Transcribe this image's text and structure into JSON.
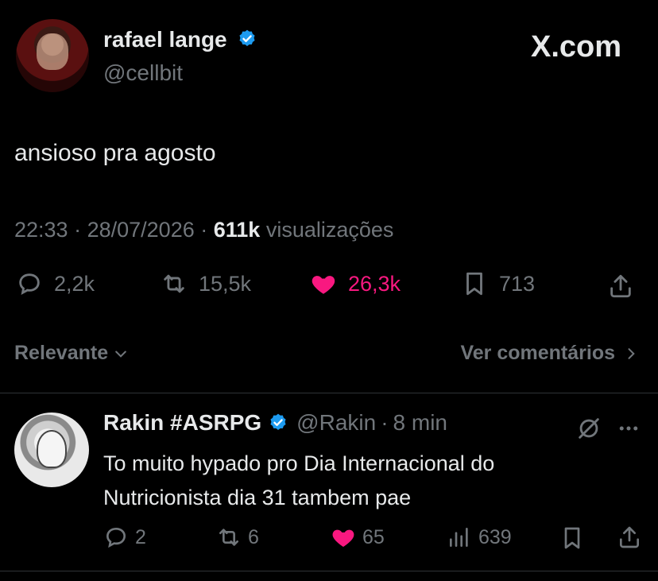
{
  "author": {
    "name": "rafael lange",
    "handle": "@cellbit"
  },
  "brand": "X.com",
  "tweet": {
    "text": "ansioso pra agosto",
    "time": "22:33",
    "date": "28/07/2026",
    "views": "611k",
    "views_label": "visualizações",
    "replies": "2,2k",
    "retweets": "15,5k",
    "likes": "26,3k",
    "bookmarks": "713"
  },
  "controls": {
    "sort_label": "Relevante",
    "see_comments_label": "Ver comentários"
  },
  "reply": {
    "name": "Rakin #ASRPG",
    "handle": "@Rakin",
    "time": "8 min",
    "text": "To muito hypado pro Dia Internacional do Nutricionista dia 31 tambem pae",
    "replies": "2",
    "retweets": "6",
    "likes": "65",
    "views": "639"
  },
  "colors": {
    "background": "#000000",
    "text": "#e7e9ea",
    "muted": "#71767b",
    "like": "#f91880",
    "verified": "#1d9bf0"
  }
}
